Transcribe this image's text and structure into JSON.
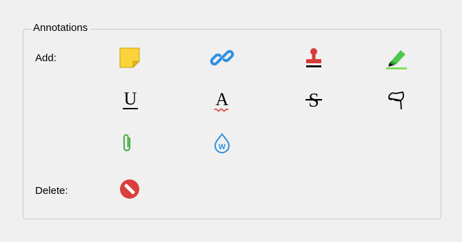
{
  "annotations": {
    "title": "Annotations",
    "add_label": "Add:",
    "delete_label": "Delete:"
  },
  "tools": {
    "sticky_note": {
      "icon": "sticky-note-icon",
      "color": "#fcd33a"
    },
    "link": {
      "icon": "link-icon",
      "color": "#2e8fe0"
    },
    "stamp": {
      "icon": "stamp-icon",
      "color": "#d83a3a"
    },
    "highlight": {
      "icon": "highlighter-icon",
      "color": "#4cc94c"
    },
    "underline": {
      "icon": "underline-icon",
      "glyph": "U",
      "color": "#000000"
    },
    "squiggly": {
      "icon": "squiggly-underline-icon",
      "glyph": "A",
      "color": "#d83a3a"
    },
    "strikeout": {
      "icon": "strikeout-icon",
      "glyph": "S",
      "color": "#000000"
    },
    "freehand": {
      "icon": "freehand-ink-icon",
      "color": "#000000"
    },
    "attachment": {
      "icon": "paperclip-icon",
      "color": "#4caf50"
    },
    "watermark": {
      "icon": "watermark-icon",
      "glyph": "W",
      "color": "#2e8fe0"
    },
    "delete": {
      "icon": "delete-prohibited-icon",
      "color": "#d9403c"
    }
  }
}
